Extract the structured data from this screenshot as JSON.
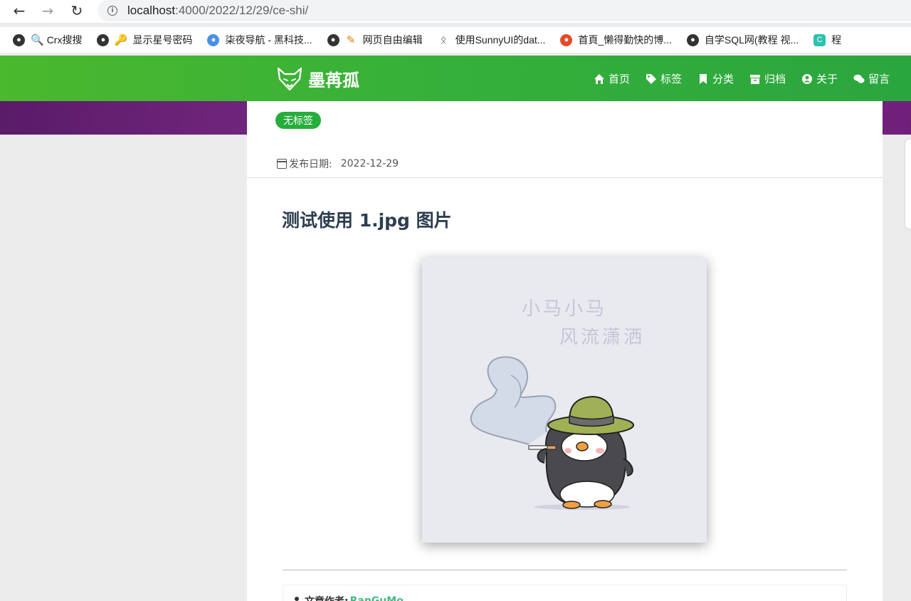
{
  "browser": {
    "url_host": "localhost",
    "url_path": ":4000/2022/12/29/ce-shi/",
    "bookmarks": [
      {
        "label": "Crx搜搜",
        "icon": "globe-icon"
      },
      {
        "label": "显示星号密码",
        "icon": "key-icon"
      },
      {
        "label": "柒夜导航 - 黑科技...",
        "icon": "blue-logo-icon"
      },
      {
        "label": "网页自由编辑",
        "icon": "edit-icon"
      },
      {
        "label": "使用SunnyUI的dat...",
        "icon": "line-icon"
      },
      {
        "label": "首頁_懒得勤快的博...",
        "icon": "red-logo-icon"
      },
      {
        "label": "自学SQL网(教程 视...",
        "icon": "globe-icon"
      },
      {
        "label": "程",
        "icon": "cyan-c-icon"
      }
    ]
  },
  "site": {
    "brand": "墨苒孤",
    "menu": [
      {
        "label": "首页",
        "icon": "home-icon"
      },
      {
        "label": "标签",
        "icon": "tag-icon"
      },
      {
        "label": "分类",
        "icon": "bookmark-icon"
      },
      {
        "label": "归档",
        "icon": "archive-icon"
      },
      {
        "label": "关于",
        "icon": "user-circle-icon"
      },
      {
        "label": "留言",
        "icon": "comments-icon"
      }
    ]
  },
  "post": {
    "tag": "无标签",
    "date_label": "发布日期:",
    "date_value": "2022-12-29",
    "title": "测试使用 1.jpg 图片",
    "image_caption_line1": "小马小马",
    "image_caption_line2": "风流潇洒",
    "author_label": "文章作者:",
    "author_name": "RanGuMo"
  },
  "colors": {
    "header_green": "#35b03a",
    "tag_green": "#27ad3c",
    "title_color": "#2d3e50",
    "hero_purple": "#7b2a86"
  }
}
